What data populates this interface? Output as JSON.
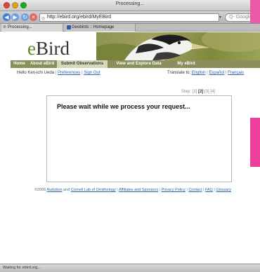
{
  "window": {
    "title": "Processing..."
  },
  "toolbar": {
    "url": "http://ebird.org/ebird/MyEBird",
    "search_placeholder": "Google"
  },
  "tabs": [
    {
      "label": "Processing..."
    },
    {
      "label": "Geobirds :: Homepage"
    }
  ],
  "site": {
    "logo_e": "e",
    "logo_rest": "Bird",
    "nav": [
      "Home",
      "About eBird",
      "Submit Observations",
      "View and Explore Data",
      "My eBird"
    ]
  },
  "user": {
    "greeting": "Hello Ken-ichi Ueda",
    "preferences": "Preferences",
    "sign_out": "Sign Out",
    "translate_label": "Translate to:",
    "languages": [
      "English",
      "Español",
      "Français"
    ]
  },
  "steps": {
    "label": "Step:",
    "s1": "[1]",
    "s2": "[2]",
    "s3": "[3]",
    "s4": "[4]"
  },
  "main": {
    "wait_message": "Please wait while we process your request..."
  },
  "footer": {
    "copyright": "©2006",
    "audubon": "Audubon",
    "and": "and",
    "cornell": "Cornell Lab of Ornithology",
    "links": [
      "Affiliates and Sponsors",
      "Privacy Policy",
      "Contact",
      "FAQ",
      "Glossary"
    ]
  },
  "status": {
    "text": "Waiting for ebird.org..."
  },
  "colors": {
    "nav_bar": "#8a8f5c",
    "nav_active": "#d6d8b8",
    "link": "#2b63a8",
    "overlay_pink": "#ec3f9c"
  }
}
